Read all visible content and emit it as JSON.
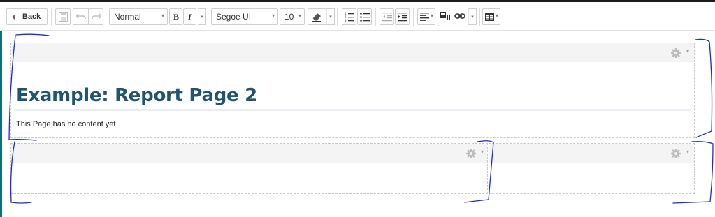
{
  "toolbar": {
    "back_label": "Back",
    "paragraph_style": "Normal",
    "font_family": "Segoe UI",
    "font_size": "10",
    "bold_label": "B",
    "italic_label": "I"
  },
  "page": {
    "title": "Example: Report Page 2",
    "body_text": "This Page has no content yet"
  },
  "icons": {
    "back": "chevron-left-icon",
    "save": "save-icon",
    "undo": "undo-icon",
    "redo": "redo-icon",
    "eraser": "eraser-icon",
    "ordered_list": "ordered-list-icon",
    "unordered_list": "unordered-list-icon",
    "outdent": "outdent-icon",
    "indent": "indent-icon",
    "align": "align-icon",
    "media": "media-icon",
    "link": "link-icon",
    "table": "table-icon",
    "gear": "gear-icon"
  },
  "colors": {
    "title": "#1f5572",
    "annotation": "#1d2bd6",
    "section_header": "#f4f4f4"
  }
}
